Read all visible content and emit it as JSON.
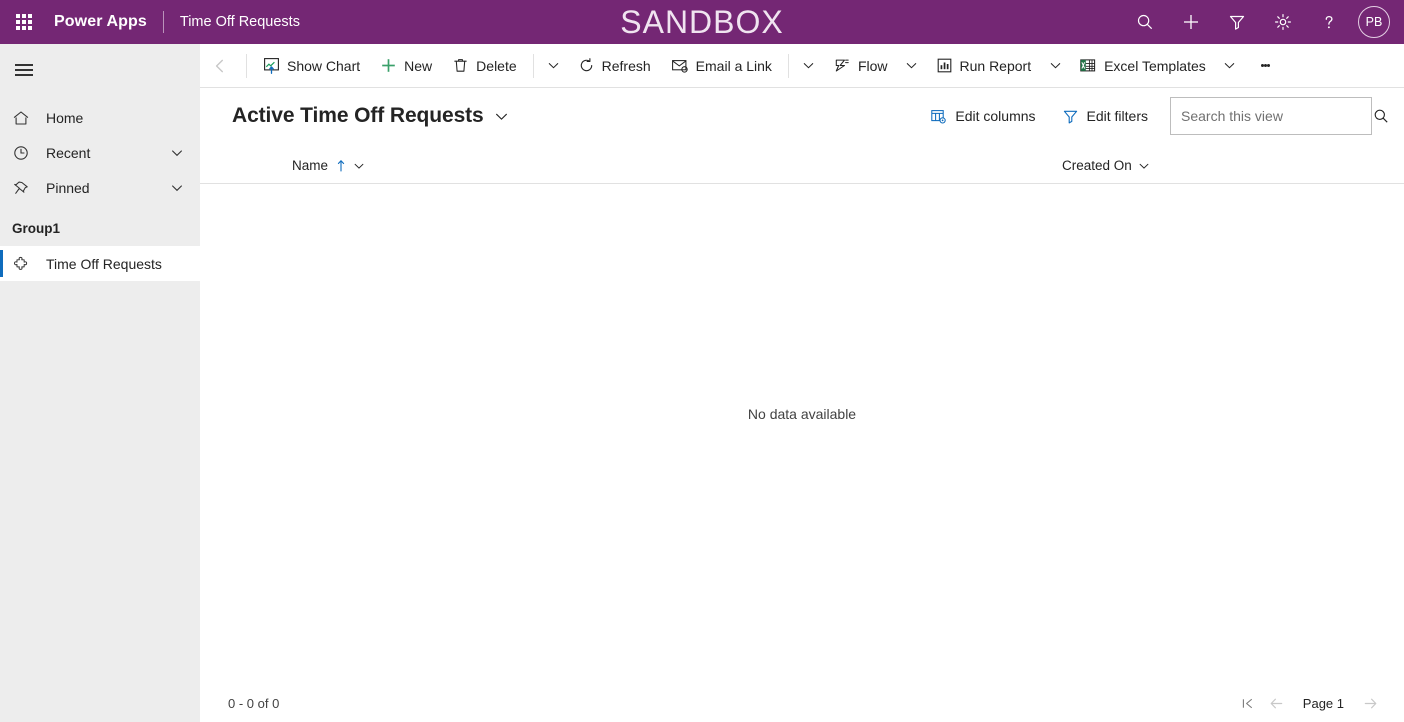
{
  "topbar": {
    "waffle_icon": "app-launcher-icon",
    "brand": "Power Apps",
    "app_title": "Time Off Requests",
    "environment_banner": "SANDBOX",
    "icons": [
      {
        "name": "search-icon",
        "label": "Search"
      },
      {
        "name": "plus-icon",
        "label": "New"
      },
      {
        "name": "filter-icon",
        "label": "Filter"
      },
      {
        "name": "gear-icon",
        "label": "Settings"
      },
      {
        "name": "help-icon",
        "label": "Help"
      }
    ],
    "avatar_initials": "PB",
    "background_color": "#742774"
  },
  "sidebar": {
    "hamburger_icon": "hamburger-icon",
    "items": [
      {
        "label": "Home",
        "icon": "home-icon",
        "chevron": false,
        "selected": false
      },
      {
        "label": "Recent",
        "icon": "clock-icon",
        "chevron": true,
        "selected": false
      },
      {
        "label": "Pinned",
        "icon": "pin-icon",
        "chevron": true,
        "selected": false
      }
    ],
    "group_label": "Group1",
    "group_items": [
      {
        "label": "Time Off Requests",
        "icon": "puzzle-icon",
        "selected": true
      }
    ],
    "background_color": "#ededed",
    "selected_accent_color": "#0f6cbd"
  },
  "commandbar": {
    "back_icon": "back-arrow-icon",
    "buttons": [
      {
        "label": "Show Chart",
        "icon": "chart-icon",
        "chevron": false
      },
      {
        "label": "New",
        "icon": "plus-icon",
        "chevron": false
      },
      {
        "label": "Delete",
        "icon": "trash-icon",
        "chevron": true
      },
      {
        "label": "Refresh",
        "icon": "refresh-icon",
        "chevron": false
      },
      {
        "label": "Email a Link",
        "icon": "email-link-icon",
        "chevron": true
      },
      {
        "label": "Flow",
        "icon": "flow-icon",
        "chevron": true
      },
      {
        "label": "Run Report",
        "icon": "report-icon",
        "chevron": true
      },
      {
        "label": "Excel Templates",
        "icon": "excel-icon",
        "chevron": true
      }
    ],
    "overflow_label": "More commands"
  },
  "view": {
    "title": "Active Time Off Requests",
    "title_chevron_icon": "chevron-down-icon",
    "edit_columns_label": "Edit columns",
    "edit_columns_icon": "edit-columns-icon",
    "edit_filters_label": "Edit filters",
    "edit_filters_icon": "filter-icon",
    "search_placeholder": "Search this view",
    "search_value": "",
    "search_icon": "search-icon"
  },
  "grid": {
    "columns": [
      {
        "label": "Name",
        "sorted": "asc",
        "sort_icon": "sort-asc-arrow-icon"
      },
      {
        "label": "Created On",
        "sorted": "none",
        "sort_icon": ""
      }
    ],
    "rows": [],
    "empty_message": "No data available"
  },
  "footer": {
    "record_count": "0 - 0 of 0",
    "first_page_icon": "first-page-icon",
    "prev_page_icon": "previous-page-icon",
    "page_label": "Page 1",
    "next_page_icon": "next-page-icon"
  }
}
